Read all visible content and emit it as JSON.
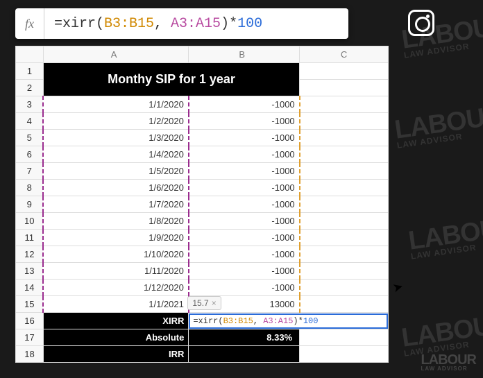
{
  "formula_bar": {
    "fx": "fx",
    "raw": "=xirr(B3:B15, A3:A15)*100",
    "prefix": "=xirr(",
    "range1": "B3:B15",
    "sep": ", ",
    "range2": "A3:A15",
    "suffix": ")*",
    "num": "100"
  },
  "columns": {
    "a": "A",
    "b": "B",
    "c": "C"
  },
  "title": "Monthy SIP for 1 year",
  "rows": [
    {
      "n": "3",
      "a": "1/1/2020",
      "b": "-1000"
    },
    {
      "n": "4",
      "a": "1/2/2020",
      "b": "-1000"
    },
    {
      "n": "5",
      "a": "1/3/2020",
      "b": "-1000"
    },
    {
      "n": "6",
      "a": "1/4/2020",
      "b": "-1000"
    },
    {
      "n": "7",
      "a": "1/5/2020",
      "b": "-1000"
    },
    {
      "n": "8",
      "a": "1/6/2020",
      "b": "-1000"
    },
    {
      "n": "9",
      "a": "1/7/2020",
      "b": "-1000"
    },
    {
      "n": "10",
      "a": "1/8/2020",
      "b": "-1000"
    },
    {
      "n": "11",
      "a": "1/9/2020",
      "b": "-1000"
    },
    {
      "n": "12",
      "a": "1/10/2020",
      "b": "-1000"
    },
    {
      "n": "13",
      "a": "1/11/2020",
      "b": "-1000"
    },
    {
      "n": "14",
      "a": "1/12/2020",
      "b": "-1000"
    },
    {
      "n": "15",
      "a": "1/1/2021",
      "b": "13000"
    }
  ],
  "footer": {
    "xirr_label": "XIRR",
    "abs_label": "Absolute",
    "abs_value": "8.33%",
    "irr_label": "IRR"
  },
  "active_cell": {
    "hint": "15.7",
    "hint_x": "×",
    "prefix": "=xirr(",
    "range1": "B3:B15",
    "sep": ", ",
    "range2": "A3:A15",
    "suffix": ")*",
    "num": "100"
  },
  "row_heads": {
    "r1": "1",
    "r2": "2",
    "r16": "16",
    "r17": "17",
    "r18": "18"
  },
  "watermark": {
    "main": "LABOUR",
    "sub": "LAW ADVISOR"
  }
}
